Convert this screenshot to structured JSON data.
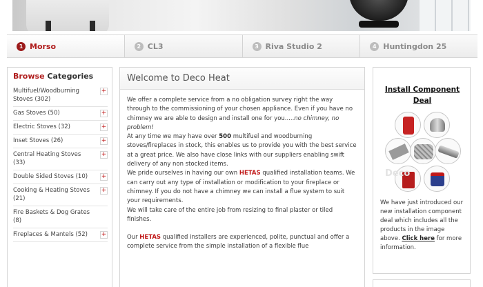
{
  "tabs": [
    {
      "num": "1",
      "label": "Morso"
    },
    {
      "num": "2",
      "label": "CL3"
    },
    {
      "num": "3",
      "label": "Riva Studio 2"
    },
    {
      "num": "4",
      "label": "Huntingdon 25"
    }
  ],
  "sidebar": {
    "title_accent": "Browse",
    "title_rest": " Categories",
    "plus": "+",
    "items": [
      {
        "label": "Multifuel/Woodburning Stoves (302)"
      },
      {
        "label": "Gas Stoves (50)"
      },
      {
        "label": "Electric Stoves (32)"
      },
      {
        "label": "Inset Stoves (26)"
      },
      {
        "label": "Central Heating Stoves (33)"
      },
      {
        "label": "Double Sided Stoves (10)"
      },
      {
        "label": "Cooking & Heating Stoves (21)"
      },
      {
        "label": "Fire Baskets & Dog Grates (8)"
      },
      {
        "label": "Fireplaces & Mantels (52)"
      }
    ]
  },
  "main": {
    "title": "Welcome to Deco Heat",
    "p1": "We offer a complete service from a no obligation survey right the way through to the commissioning of your chosen appliance. Even if you have no chimney we are able to design and install one for you.....",
    "p1_em": "no chimney, no problem!",
    "p2_a": "At any time we may have over ",
    "p2_bold": "500",
    "p2_b": " multifuel and woodburning stoves/fireplaces in stock, this enables us to provide you with the best service at a great price. We also have close links with our suppliers enabling swift delivery of any non stocked items.",
    "p3_a": "We pride ourselves in having our own ",
    "hetas": "HETAS",
    "p3_b": " qualified installation teams. We can carry out any type of installation or modification to your fireplace or chimney. If you do not have a chimney we can install a flue system to suit your requirements.",
    "p4": "We will take care of the entire job from resizing to final plaster or tiled finishes.",
    "p5_a": "Our ",
    "p5_b": " qualified installers are experienced, polite, punctual and offer a complete service from the simple installation of a flexible flue"
  },
  "rightbox": {
    "title": "Install Component Deal",
    "watermark": "Deco",
    "text_a": "We have just introduced our new installation component deal which includes all the products in the image above. ",
    "link": "Click here",
    "text_b": " for more information."
  },
  "colors": {
    "accent": "#b01e1e",
    "hetas": "#c01818"
  }
}
